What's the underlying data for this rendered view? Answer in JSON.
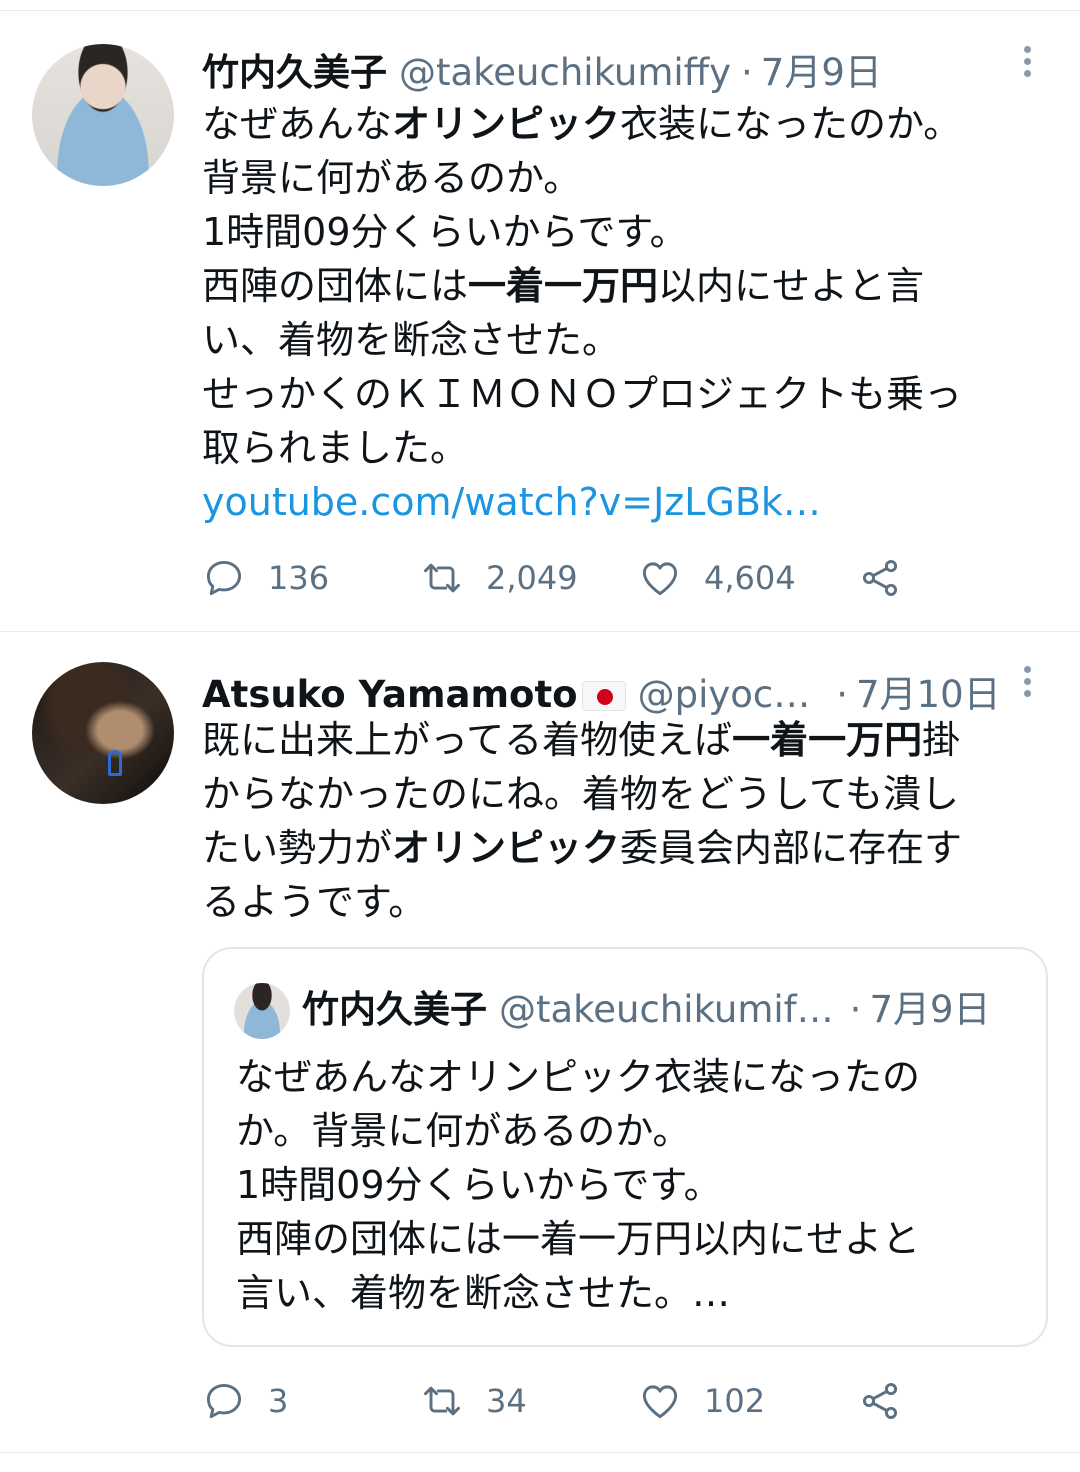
{
  "tweets": [
    {
      "author_name": "竹内久美子",
      "handle": "@takeuchikumiffy",
      "separator": "·",
      "date": "7月9日",
      "lines": [
        [
          "なぜあんな",
          "オリンピック",
          "衣装になったのか。"
        ],
        [
          "背景に何があるのか。"
        ],
        [
          "1時間09分くらいからです。"
        ],
        [
          "西陣の団体には",
          "一着一万円",
          "以内にせよと言"
        ],
        [
          "い、着物を断念させた。"
        ],
        [
          "せっかくのＫＩＭＯＮＯプロジェクトも乗っ"
        ],
        [
          "取られました。"
        ]
      ],
      "link": "youtube.com/watch?v=JzLGBk…",
      "replies": "136",
      "retweets": "2,049",
      "likes": "4,604"
    },
    {
      "author_name": "Atsuko Yamamoto",
      "handle": "@piyoc…",
      "separator": "·",
      "date": "7月10日",
      "lines": [
        [
          "既に出来上がってる着物使えば",
          "一着一万円",
          "掛"
        ],
        [
          "からなかったのにね。着物をどうしても潰し"
        ],
        [
          "たい勢力が",
          "オリンピック",
          "委員会内部に存在す"
        ],
        [
          "るようです。"
        ]
      ],
      "quote": {
        "author_name": "竹内久美子",
        "handle": "@takeuchikumif…",
        "separator": "·",
        "date": "7月9日",
        "lines": [
          "なぜあんなオリンピック衣装になったの",
          "か。背景に何があるのか。",
          "1時間09分くらいからです。",
          "西陣の団体には一着一万円以内にせよと",
          "言い、着物を断念させた。…"
        ]
      },
      "replies": "3",
      "retweets": "34",
      "likes": "102"
    }
  ],
  "icons": {
    "reply": "reply-icon",
    "retweet": "retweet-icon",
    "like": "heart-icon",
    "share": "share-icon",
    "more": "more-options-icon"
  },
  "colors": {
    "text": "#0f1419",
    "secondary": "#5b7083",
    "link": "#1b95e0",
    "divider": "#e6ecf0"
  }
}
